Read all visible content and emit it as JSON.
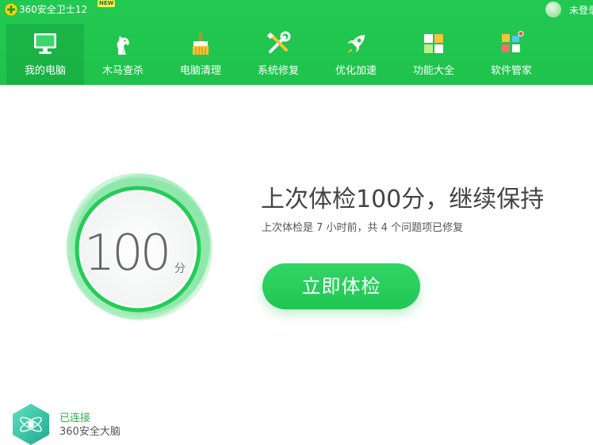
{
  "titlebar": {
    "app_title": "360安全卫士12",
    "new_badge": "NEW",
    "login_label": "未登录"
  },
  "nav": {
    "items": [
      {
        "label": "我的电脑",
        "icon": "monitor-icon",
        "active": true
      },
      {
        "label": "木马查杀",
        "icon": "horse-icon",
        "active": false
      },
      {
        "label": "电脑清理",
        "icon": "broom-icon",
        "active": false
      },
      {
        "label": "系统修复",
        "icon": "wrench-screwdriver-icon",
        "active": false
      },
      {
        "label": "优化加速",
        "icon": "rocket-icon",
        "active": false
      },
      {
        "label": "功能大全",
        "icon": "grid-icon",
        "active": false
      },
      {
        "label": "软件管家",
        "icon": "software-tiles-icon",
        "active": false
      }
    ]
  },
  "score": {
    "value": "100",
    "unit": "分"
  },
  "summary": {
    "headline": "上次体检100分，继续保持",
    "subline": "上次体检是 7 小时前，共 4 个问题项已修复"
  },
  "actions": {
    "check_label": "立即体检"
  },
  "brain": {
    "status": "已连接",
    "name": "360安全大脑"
  },
  "colors": {
    "brand_green": "#22c951",
    "button_green": "#26cc5a",
    "status_green": "#2cb34f"
  }
}
